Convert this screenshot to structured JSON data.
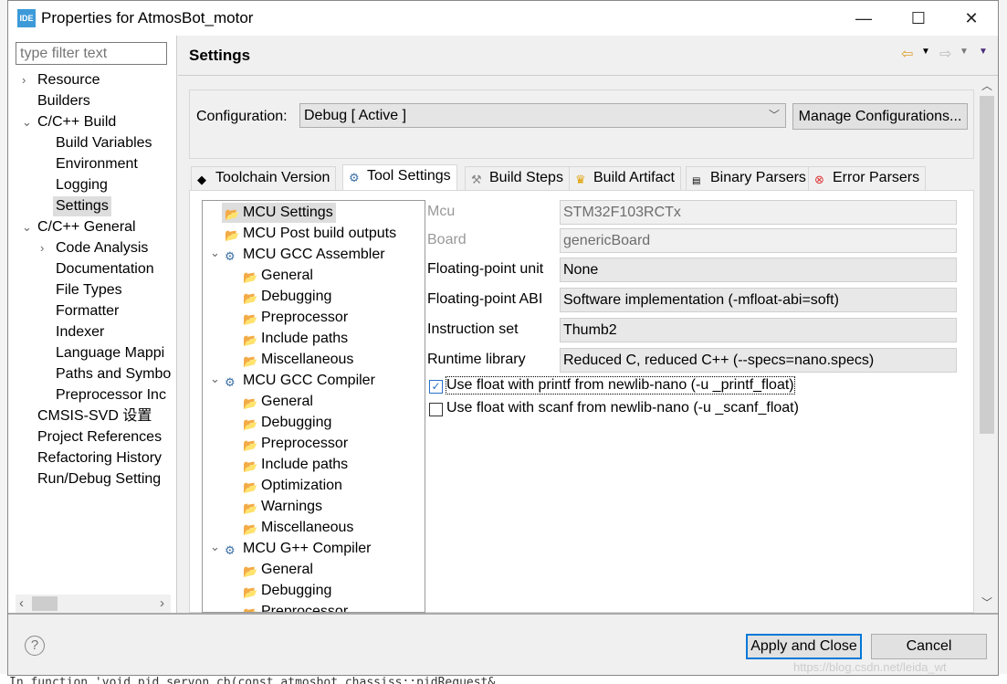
{
  "window": {
    "title": "Properties for AtmosBot_motor",
    "app_icon_text": "IDE",
    "minimize": "—",
    "maximize": "☐",
    "close": "✕"
  },
  "sidebar": {
    "filter_placeholder": "type filter text",
    "items": [
      {
        "label": "Resource",
        "level": 0,
        "twisty": ">"
      },
      {
        "label": "Builders",
        "level": 0,
        "twisty": ""
      },
      {
        "label": "C/C++ Build",
        "level": 0,
        "twisty": "v"
      },
      {
        "label": "Build Variables",
        "level": 1,
        "twisty": ""
      },
      {
        "label": "Environment",
        "level": 1,
        "twisty": ""
      },
      {
        "label": "Logging",
        "level": 1,
        "twisty": ""
      },
      {
        "label": "Settings",
        "level": 1,
        "twisty": "",
        "selected": true
      },
      {
        "label": "C/C++ General",
        "level": 0,
        "twisty": "v"
      },
      {
        "label": "Code Analysis",
        "level": 1,
        "twisty": ">"
      },
      {
        "label": "Documentation",
        "level": 1,
        "twisty": ""
      },
      {
        "label": "File Types",
        "level": 1,
        "twisty": ""
      },
      {
        "label": "Formatter",
        "level": 1,
        "twisty": ""
      },
      {
        "label": "Indexer",
        "level": 1,
        "twisty": ""
      },
      {
        "label": "Language Mappi",
        "level": 1,
        "twisty": ""
      },
      {
        "label": "Paths and Symbo",
        "level": 1,
        "twisty": ""
      },
      {
        "label": "Preprocessor Inc",
        "level": 1,
        "twisty": ""
      },
      {
        "label": "CMSIS-SVD 设置",
        "level": 0,
        "twisty": ""
      },
      {
        "label": "Project References",
        "level": 0,
        "twisty": ""
      },
      {
        "label": "Refactoring History",
        "level": 0,
        "twisty": ""
      },
      {
        "label": "Run/Debug Setting",
        "level": 0,
        "twisty": ""
      }
    ]
  },
  "header": {
    "title": "Settings"
  },
  "configuration": {
    "label": "Configuration:",
    "value": "Debug  [ Active ]",
    "manage_button": "Manage Configurations..."
  },
  "tabs": [
    {
      "label": "Toolchain  Version",
      "icon": "chip"
    },
    {
      "label": "Tool Settings",
      "icon": "gear",
      "active": true
    },
    {
      "label": "Build Steps",
      "icon": "hammer"
    },
    {
      "label": "Build Artifact",
      "icon": "trophy"
    },
    {
      "label": "Binary Parsers",
      "icon": "binary"
    },
    {
      "label": "Error Parsers",
      "icon": "error"
    }
  ],
  "tool_tree": [
    {
      "label": "MCU Settings",
      "level": 0,
      "twisty": "",
      "selected": true
    },
    {
      "label": "MCU Post build outputs",
      "level": 0,
      "twisty": ""
    },
    {
      "label": "MCU GCC Assembler",
      "level": 0,
      "twisty": "v"
    },
    {
      "label": "General",
      "level": 1
    },
    {
      "label": "Debugging",
      "level": 1
    },
    {
      "label": "Preprocessor",
      "level": 1
    },
    {
      "label": "Include paths",
      "level": 1
    },
    {
      "label": "Miscellaneous",
      "level": 1
    },
    {
      "label": "MCU GCC Compiler",
      "level": 0,
      "twisty": "v"
    },
    {
      "label": "General",
      "level": 1
    },
    {
      "label": "Debugging",
      "level": 1
    },
    {
      "label": "Preprocessor",
      "level": 1
    },
    {
      "label": "Include paths",
      "level": 1
    },
    {
      "label": "Optimization",
      "level": 1
    },
    {
      "label": "Warnings",
      "level": 1
    },
    {
      "label": "Miscellaneous",
      "level": 1
    },
    {
      "label": "MCU G++ Compiler",
      "level": 0,
      "twisty": "v"
    },
    {
      "label": "General",
      "level": 1
    },
    {
      "label": "Debugging",
      "level": 1
    },
    {
      "label": "Preprocessor",
      "level": 1
    }
  ],
  "form": {
    "rows": [
      {
        "label": "Mcu",
        "value": "STM32F103RCTx",
        "disabled": true
      },
      {
        "label": "Board",
        "value": "genericBoard",
        "disabled": true
      },
      {
        "label": "Floating-point unit",
        "value": "None"
      },
      {
        "label": "Floating-point ABI",
        "value": "Software implementation (-mfloat-abi=soft)"
      },
      {
        "label": "Instruction set",
        "value": "Thumb2"
      },
      {
        "label": "Runtime library",
        "value": "Reduced C, reduced C++ (--specs=nano.specs)"
      }
    ],
    "checkboxes": [
      {
        "label": "Use float with printf from newlib-nano (-u _printf_float)",
        "checked": true
      },
      {
        "label": "Use float with scanf from newlib-nano (-u _scanf_float)",
        "checked": false
      }
    ]
  },
  "footer": {
    "help": "?",
    "apply_close": "Apply and Close",
    "cancel": "Cancel"
  },
  "background": {
    "console_text": "In function 'void pid_servon_cb(const atmosbot_chassiss::pidRequest&",
    "watermark": "https://blog.csdn.net/leida_wt"
  },
  "colors": {
    "accent": "#0078d7",
    "selection": "#dddddd"
  }
}
